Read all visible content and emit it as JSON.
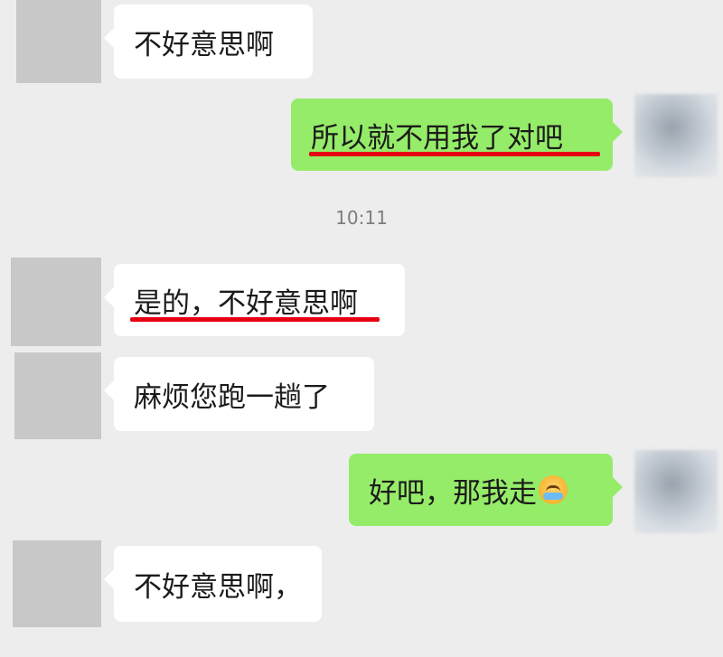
{
  "colors": {
    "background": "#ededed",
    "incoming_bubble": "#ffffff",
    "outgoing_bubble": "#95ec69",
    "underline": "#e60012",
    "avatar_placeholder": "#c8c8c8"
  },
  "timestamp": "10:11",
  "messages": [
    {
      "side": "in",
      "text": "不好意思啊"
    },
    {
      "side": "out",
      "text": "所以就不用我了对吧",
      "underlined": true
    },
    {
      "side": "in",
      "text": "是的，不好意思啊",
      "underlined": true
    },
    {
      "side": "in",
      "text": "麻烦您跑一趟了"
    },
    {
      "side": "out",
      "text": "好吧，那我走",
      "emoji": "crying-laughing-emoji"
    },
    {
      "side": "in",
      "text": "不好意思啊，"
    }
  ]
}
